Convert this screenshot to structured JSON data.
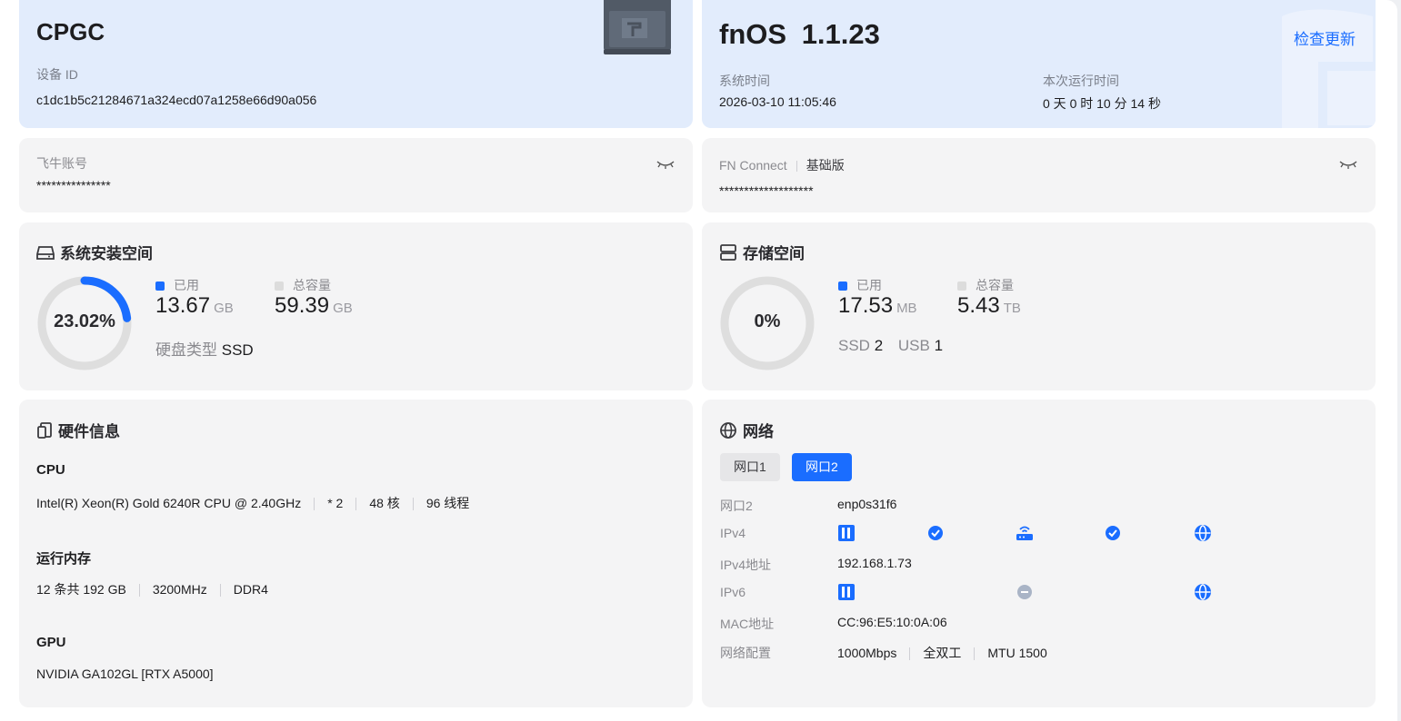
{
  "device": {
    "name": "CPGC",
    "id_label": "设备 ID",
    "id_value": "c1dc1b5c21284671a324ecd07a1258e66d90a056"
  },
  "os": {
    "name": "fnOS",
    "version": "1.1.23",
    "check_update": "检查更新",
    "time_label": "系统时间",
    "time_value": "2026-03-10 11:05:46",
    "uptime_label": "本次运行时间",
    "uptime_value": "0 天 0 时 10 分 14 秒"
  },
  "account": {
    "label": "飞牛账号",
    "value": "***************"
  },
  "fnconnect": {
    "label": "FN Connect",
    "plan": "基础版",
    "value": "*******************"
  },
  "system_space": {
    "title": "系统安装空间",
    "percent_text": "23.02%",
    "percent": 23.02,
    "used_label": "已用",
    "used_value": "13.67",
    "used_unit": "GB",
    "total_label": "总容量",
    "total_value": "59.39",
    "total_unit": "GB",
    "disk_type_label": "硬盘类型",
    "disk_type_value": "SSD"
  },
  "storage": {
    "title": "存储空间",
    "percent_text": "0%",
    "percent": 0,
    "used_label": "已用",
    "used_value": "17.53",
    "used_unit": "MB",
    "total_label": "总容量",
    "total_value": "5.43",
    "total_unit": "TB",
    "ssd_label": "SSD",
    "ssd_count": "2",
    "usb_label": "USB",
    "usb_count": "1"
  },
  "hardware": {
    "title": "硬件信息",
    "cpu_label": "CPU",
    "cpu_model": "Intel(R) Xeon(R) Gold 6240R CPU @ 2.40GHz",
    "cpu_count": "* 2",
    "cpu_cores": "48 核",
    "cpu_threads": "96 线程",
    "mem_label": "运行内存",
    "mem_size": "12 条共 192 GB",
    "mem_speed": "3200MHz",
    "mem_type": "DDR4",
    "gpu_label": "GPU",
    "gpu_model": "NVIDIA GA102GL [RTX A5000]"
  },
  "network": {
    "title": "网络",
    "tabs": [
      "网口1",
      "网口2"
    ],
    "active_tab": "网口2",
    "port_label": "网口2",
    "port_value": "enp0s31f6",
    "ipv4_label": "IPv4",
    "ipv4_addr_label": "IPv4地址",
    "ipv4_addr_value": "192.168.1.73",
    "ipv6_label": "IPv6",
    "mac_label": "MAC地址",
    "mac_value": "CC:96:E5:10:0A:06",
    "config_label": "网络配置",
    "speed": "1000Mbps",
    "duplex": "全双工",
    "mtu": "MTU 1500"
  },
  "colors": {
    "accent": "#1a6dff",
    "card_bg": "#f4f4f5",
    "blue_card_bg": "#e2ecfc",
    "ring_track": "#dedede",
    "muted_icon": "#a9b4c6"
  }
}
